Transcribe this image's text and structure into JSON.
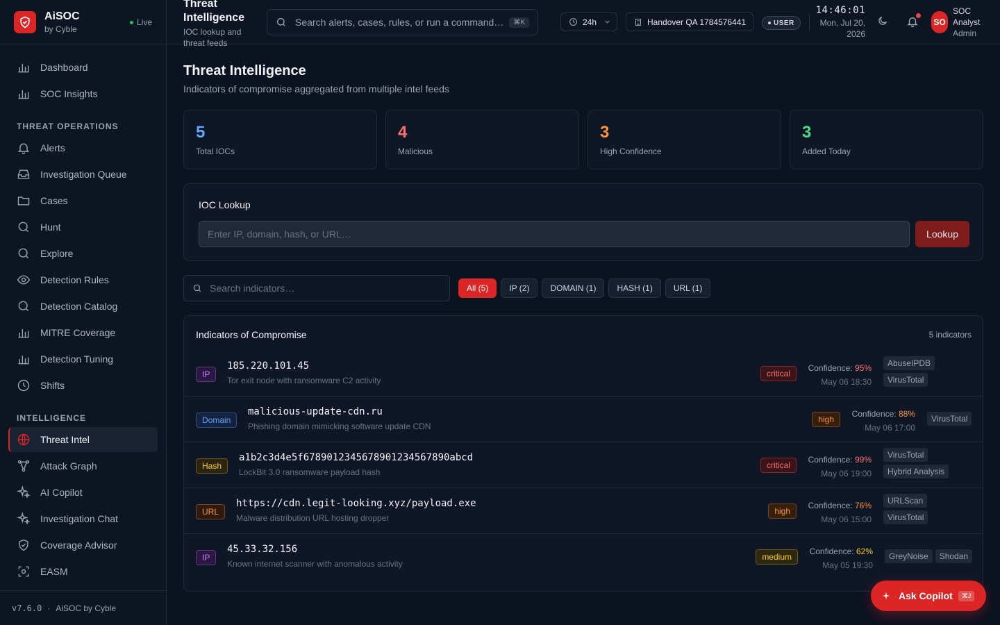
{
  "brand": {
    "name": "AiSOC",
    "sub": "by Cyble",
    "status": "Live"
  },
  "nav": {
    "top": [
      {
        "label": "Dashboard",
        "icon": "bar-chart-icon"
      },
      {
        "label": "SOC Insights",
        "icon": "bar-chart-icon"
      }
    ],
    "section1": "THREAT OPERATIONS",
    "threat_ops": [
      {
        "label": "Alerts",
        "icon": "bell-icon"
      },
      {
        "label": "Investigation Queue",
        "icon": "inbox-icon"
      },
      {
        "label": "Cases",
        "icon": "folder-icon"
      },
      {
        "label": "Hunt",
        "icon": "search-icon"
      },
      {
        "label": "Explore",
        "icon": "search-icon"
      },
      {
        "label": "Detection Rules",
        "icon": "eye-icon"
      },
      {
        "label": "Detection Catalog",
        "icon": "search-icon"
      },
      {
        "label": "MITRE Coverage",
        "icon": "bar-chart-icon"
      },
      {
        "label": "Detection Tuning",
        "icon": "bar-chart-icon"
      },
      {
        "label": "Shifts",
        "icon": "clock-icon"
      }
    ],
    "section2": "INTELLIGENCE",
    "intel": [
      {
        "label": "Threat Intel",
        "icon": "globe-icon",
        "active": true
      },
      {
        "label": "Attack Graph",
        "icon": "graph-icon"
      },
      {
        "label": "AI Copilot",
        "icon": "sparkles-icon"
      },
      {
        "label": "Investigation Chat",
        "icon": "sparkles-icon"
      },
      {
        "label": "Coverage Advisor",
        "icon": "shield-icon"
      },
      {
        "label": "EASM",
        "icon": "scan-icon"
      }
    ]
  },
  "footer": {
    "version": "v7.6.0",
    "sep": "·",
    "brand": "AiSOC by Cyble"
  },
  "topbar": {
    "title": "Threat Intelligence",
    "subtitle": "IOC lookup and threat feeds",
    "search_placeholder": "Search alerts, cases, rules, or run a command…",
    "search_kbd": "⌘K",
    "range": "24h",
    "handover": "Handover QA 1784576441",
    "role_badge": "USER",
    "time": "14:46:01",
    "date": "Mon, Jul 20, 2026",
    "avatar": "SO",
    "profile_name": "SOC Analyst",
    "profile_role": "Admin"
  },
  "page": {
    "title": "Threat Intelligence",
    "subtitle": "Indicators of compromise aggregated from multiple intel feeds"
  },
  "stats": [
    {
      "value": "5",
      "label": "Total IOCs",
      "color": "#60a5fa"
    },
    {
      "value": "4",
      "label": "Malicious",
      "color": "#f87171"
    },
    {
      "value": "3",
      "label": "High Confidence",
      "color": "#fb923c"
    },
    {
      "value": "3",
      "label": "Added Today",
      "color": "#4ade80"
    }
  ],
  "lookup": {
    "title": "IOC Lookup",
    "placeholder": "Enter IP, domain, hash, or URL…",
    "button": "Lookup"
  },
  "filters": {
    "search_placeholder": "Search indicators…",
    "chips": [
      {
        "label": "All (5)",
        "active": true
      },
      {
        "label": "IP (2)"
      },
      {
        "label": "DOMAIN (1)"
      },
      {
        "label": "HASH (1)"
      },
      {
        "label": "URL (1)"
      }
    ]
  },
  "iocs": {
    "title": "Indicators of Compromise",
    "count": "5 indicators",
    "rows": [
      {
        "type": "IP",
        "value": "185.220.101.45",
        "desc": "Tor exit node with ransomware C2 activity",
        "severity": "critical",
        "confidence_label": "Confidence:",
        "confidence": "95%",
        "time": "May 06 18:30",
        "sources": [
          "AbuseIPDB",
          "VirusTotal"
        ]
      },
      {
        "type": "Domain",
        "value": "malicious-update-cdn.ru",
        "desc": "Phishing domain mimicking software update CDN",
        "severity": "high",
        "confidence_label": "Confidence:",
        "confidence": "88%",
        "time": "May 06 17:00",
        "sources": [
          "VirusTotal"
        ]
      },
      {
        "type": "Hash",
        "value": "a1b2c3d4e5f67890123456789012345678 90abcd",
        "desc": "LockBit 3.0 ransomware payload hash",
        "severity": "critical",
        "confidence_label": "Confidence:",
        "confidence": "99%",
        "time": "May 06 19:00",
        "sources": [
          "VirusTotal",
          "Hybrid Analysis"
        ]
      },
      {
        "type": "URL",
        "value": "https://cdn.legit-looking.xyz/payload.exe",
        "desc": "Malware distribution URL hosting dropper",
        "severity": "high",
        "confidence_label": "Confidence:",
        "confidence": "76%",
        "time": "May 06 15:00",
        "sources": [
          "URLScan",
          "VirusTotal"
        ]
      },
      {
        "type": "IP",
        "value": "45.33.32.156",
        "desc": "Known internet scanner with anomalous activity",
        "severity": "medium",
        "confidence_label": "Confidence:",
        "confidence": "62%",
        "time": "May 05 19:30",
        "sources": [
          "GreyNoise",
          "Shodan"
        ]
      }
    ]
  },
  "copilot": {
    "label": "Ask Copilot",
    "kbd": "⌘J"
  },
  "colors": {
    "accent": "#dc2626",
    "critical": "#f87171",
    "high": "#fb923c",
    "medium": "#facc15"
  }
}
